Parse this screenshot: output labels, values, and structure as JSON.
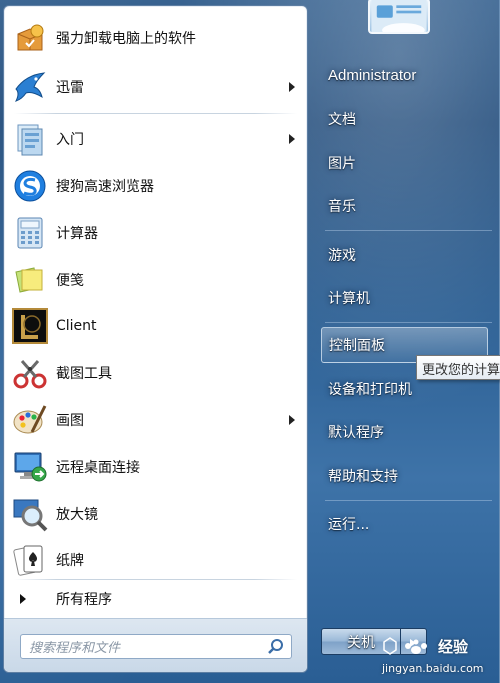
{
  "programs": [
    {
      "label": "强力卸载电脑上的软件",
      "icon": "uninstall-box-icon",
      "submenu": false
    },
    {
      "label": "迅雷",
      "icon": "thunder-bird-icon",
      "submenu": true
    },
    {
      "label": "入门",
      "icon": "getting-started-icon",
      "submenu": true
    },
    {
      "label": "搜狗高速浏览器",
      "icon": "sogou-browser-icon",
      "submenu": false
    },
    {
      "label": "计算器",
      "icon": "calculator-icon",
      "submenu": false
    },
    {
      "label": "便笺",
      "icon": "sticky-notes-icon",
      "submenu": false
    },
    {
      "label": "Client",
      "icon": "lol-client-icon",
      "submenu": false
    },
    {
      "label": "截图工具",
      "icon": "snipping-tool-icon",
      "submenu": false
    },
    {
      "label": "画图",
      "icon": "paint-icon",
      "submenu": true
    },
    {
      "label": "远程桌面连接",
      "icon": "remote-desktop-icon",
      "submenu": false
    },
    {
      "label": "放大镜",
      "icon": "magnifier-icon",
      "submenu": false
    },
    {
      "label": "纸牌",
      "icon": "solitaire-icon",
      "submenu": false
    }
  ],
  "all_programs": "所有程序",
  "search": {
    "placeholder": "搜索程序和文件"
  },
  "right": {
    "user": "Administrator",
    "documents": "文档",
    "pictures": "图片",
    "music": "音乐",
    "games": "游戏",
    "computer": "计算机",
    "control_panel": "控制面板",
    "devices_printers": "设备和打印机",
    "default_programs": "默认程序",
    "help_support": "帮助和支持",
    "run": "运行..."
  },
  "tooltip": "更改您的计算",
  "shutdown": {
    "label": "关机"
  },
  "watermark": {
    "brand": "经验",
    "url": "jingyan.baidu.com"
  }
}
